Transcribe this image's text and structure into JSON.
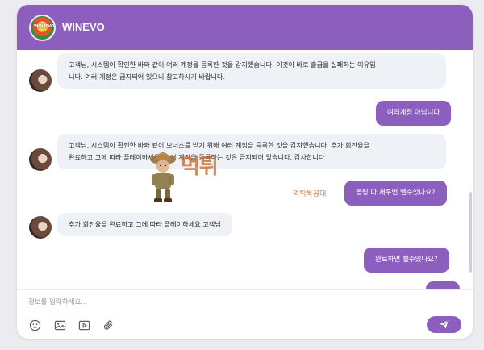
{
  "header": {
    "logo_text": "WIN JEVO",
    "title": "WINEVO",
    "color": "#8c5fbe"
  },
  "messages": [
    {
      "side": "in",
      "text_1": "고객님, 시스템이 확인한 바와 같이 여러 계정을 등록한 것을 감지했습니다. 이것이 바로 출금을 실패하는 이유입",
      "text_2": "니다. 여러 계정은 금지되어 있으니 참고하시기 바랍니다."
    },
    {
      "side": "out",
      "text": "여러계정 아닙니다"
    },
    {
      "side": "in",
      "text_1": "고객님, 시스템이 확인한 바와 같이 보너스를 받기 위해 여러 계정을 등록한 것을 감지했습니다. 추가 회전율을",
      "text_2": "완료하고 그에 따라 플레이하세요. 여러 계정을 등록하는 것은 금지되어 있습니다. 감사합니다"
    },
    {
      "side": "out",
      "text": "롤링 다 채우면 뺄수있나요?"
    },
    {
      "side": "in",
      "text": "추가 회전율을 완료하고 그에 따라 플레이하세요 고객님"
    },
    {
      "side": "out",
      "text": "완료하면 뺄수있나요?"
    }
  ],
  "watermark": {
    "main": "먹튀",
    "sub": "먹튀톡공대"
  },
  "composer": {
    "placeholder": "정보를 입력하세요...",
    "tools": [
      "emoji-icon",
      "image-icon",
      "video-icon",
      "attachment-icon"
    ],
    "send_icon": "send-icon"
  }
}
